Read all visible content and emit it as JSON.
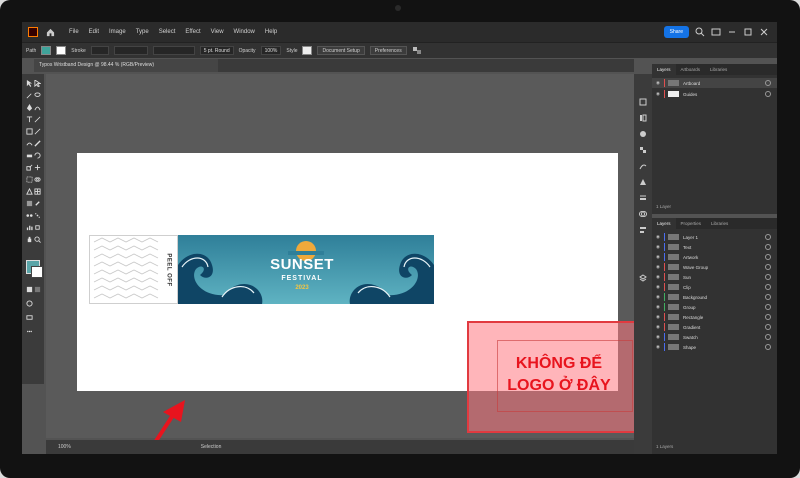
{
  "menubar": {
    "items": [
      "File",
      "Edit",
      "Image",
      "Type",
      "Select",
      "Effect",
      "View",
      "Window",
      "Help"
    ],
    "share_label": "Share"
  },
  "controlbar": {
    "selection": "Path",
    "fill_color": "#3fa39a",
    "stroke_label": "Stroke",
    "brush_label": "5 pt. Round",
    "opacity_label": "Opacity",
    "opacity_value": "100%",
    "style_label": "Style",
    "doc_setup_label": "Document Setup",
    "preferences_label": "Preferences"
  },
  "document": {
    "tab_title": "Typos Wristband Design @ 98.44 % (RGB/Preview)"
  },
  "artwork": {
    "peel_label": "PEEL OFF",
    "title_line1": "SUNSET",
    "title_line2": "FESTIVAL",
    "title_year": "2023",
    "overlay_text_line1": "KHÔNG ĐỂ",
    "overlay_text_line2": "LOGO Ở ĐÂY",
    "overlay_color": "#e8141e",
    "band_color": "#3d8fa6"
  },
  "status": {
    "zoom": "100%",
    "mode": "Selection"
  },
  "layers_panel": {
    "tabs": [
      "Layers",
      "Artboards",
      "Libraries"
    ],
    "rows": [
      "Artboard",
      "Guides"
    ],
    "footer": "1 Layer"
  },
  "layers_panel2": {
    "tabs": [
      "Layers",
      "Properties",
      "Libraries"
    ],
    "rows": [
      "Layer 1",
      "Text",
      "Artwork",
      "Wave Group",
      "Sun",
      "Clip",
      "Background",
      "Group",
      "Rectangle",
      "Gradient",
      "Swatch",
      "Shape"
    ],
    "footer": "1 Layers"
  }
}
